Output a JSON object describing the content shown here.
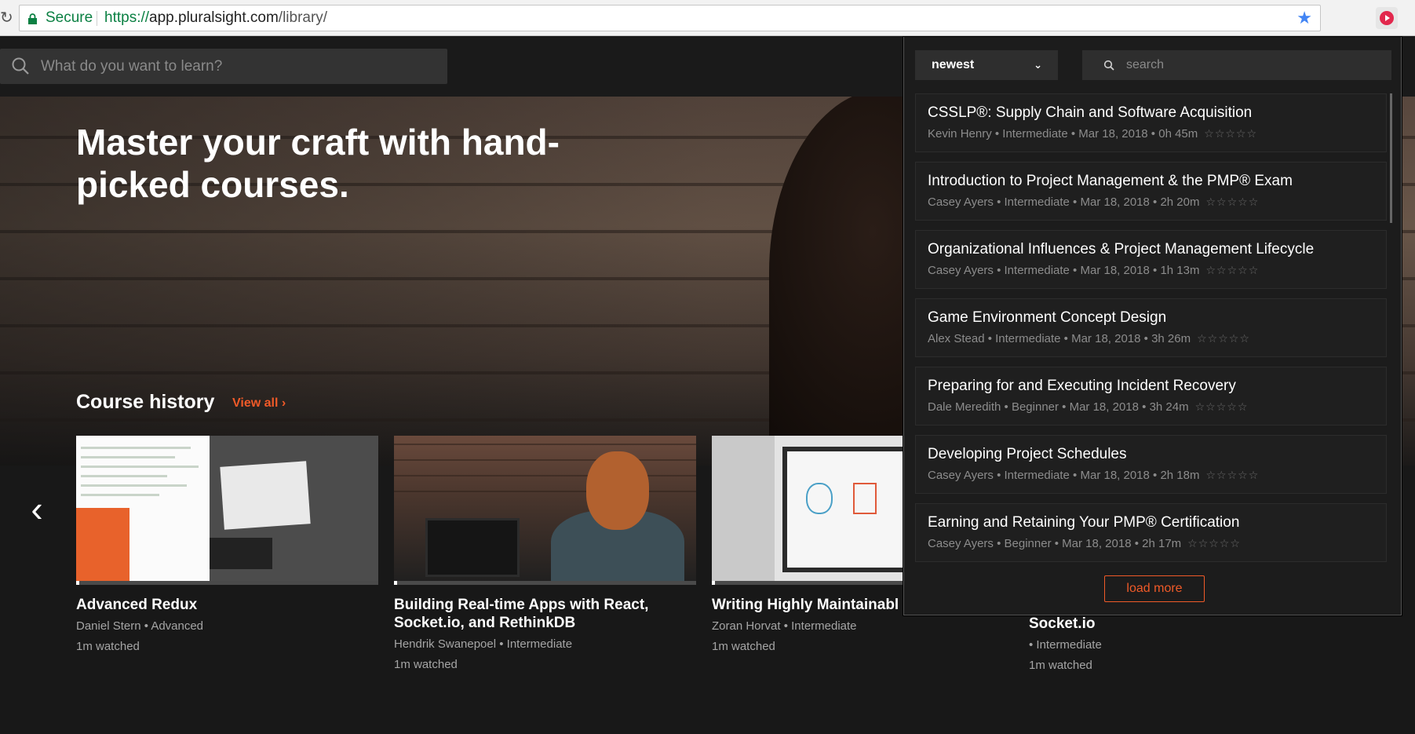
{
  "browser": {
    "secure_label": "Secure",
    "url_scheme": "https://",
    "url_host": "app.pluralsight.com",
    "url_path": "/library/"
  },
  "header": {
    "search_placeholder": "What do you want to learn?"
  },
  "hero": {
    "title": "Master your craft with hand-picked courses.",
    "history_title": "Course history",
    "view_all": "View all ›"
  },
  "cards": [
    {
      "title": "Advanced Redux",
      "author": "Daniel Stern",
      "level": "Advanced",
      "watched": "1m watched",
      "progress": 0.01
    },
    {
      "title": "Building Real-time Apps with React, Socket.io, and RethinkDB",
      "author": "Hendrik Swanepoel",
      "level": "Intermediate",
      "watched": "1m watched",
      "progress": 0.01
    },
    {
      "title": "Writing Highly Maintainabl",
      "author": "Zoran Horvat",
      "level": "Intermediate",
      "watched": "1m watched",
      "progress": 0.01
    },
    {
      "title": "Socket.io",
      "level": "• Intermediate",
      "watched": "1m watched"
    }
  ],
  "popup": {
    "sort_value": "newest",
    "search_placeholder": "search",
    "load_more": "load more",
    "courses": [
      {
        "title": "CSSLP®: Supply Chain and Software Acquisition",
        "meta": "Kevin Henry • Intermediate • Mar 18, 2018 • 0h 45m"
      },
      {
        "title": "Introduction to Project Management & the PMP® Exam",
        "meta": "Casey Ayers • Intermediate • Mar 18, 2018 • 2h 20m"
      },
      {
        "title": "Organizational Influences & Project Management Lifecycle",
        "meta": "Casey Ayers • Intermediate • Mar 18, 2018 • 1h 13m"
      },
      {
        "title": "Game Environment Concept Design",
        "meta": "Alex Stead • Intermediate • Mar 18, 2018 • 3h 26m"
      },
      {
        "title": "Preparing for and Executing Incident Recovery",
        "meta": "Dale Meredith • Beginner • Mar 18, 2018 • 3h 24m"
      },
      {
        "title": "Developing Project Schedules",
        "meta": "Casey Ayers • Intermediate • Mar 18, 2018 • 2h 18m"
      },
      {
        "title": "Earning and Retaining Your PMP® Certification",
        "meta": "Casey Ayers • Beginner • Mar 18, 2018 • 2h 17m"
      }
    ]
  },
  "colors": {
    "accent": "#f05a28",
    "secure_green": "#0b8043",
    "star_blue": "#4285f4"
  }
}
